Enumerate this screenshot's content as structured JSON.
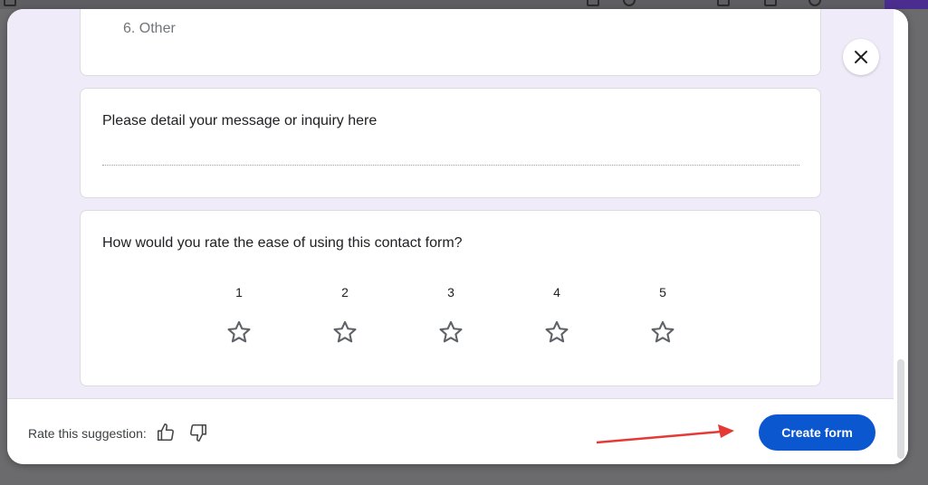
{
  "form": {
    "partial_option": "6. Other",
    "questions": [
      {
        "text": "Please detail your message or inquiry here"
      },
      {
        "text": "How would you rate the ease of using this contact form?"
      }
    ],
    "rating": {
      "labels": [
        "1",
        "2",
        "3",
        "4",
        "5"
      ],
      "icon": "star-outline-icon"
    }
  },
  "footer": {
    "rate_label": "Rate this suggestion:",
    "thumbs_up_icon": "thumbs-up-icon",
    "thumbs_down_icon": "thumbs-down-icon",
    "create_label": "Create form"
  },
  "colors": {
    "form_background": "#f0ebf8",
    "primary_button": "#0b57d0",
    "annotation_arrow": "#e53935"
  }
}
